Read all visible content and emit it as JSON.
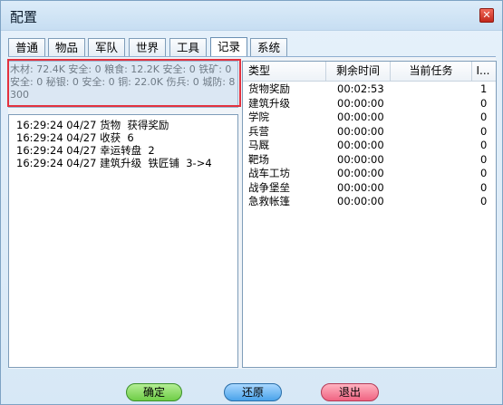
{
  "window": {
    "title": "配置"
  },
  "tabs": [
    {
      "label": "普通"
    },
    {
      "label": "物品"
    },
    {
      "label": "军队"
    },
    {
      "label": "世界"
    },
    {
      "label": "工具"
    },
    {
      "label": "记录",
      "active": true
    },
    {
      "label": "系统"
    }
  ],
  "stats": {
    "text": "木材: 72.4K 安全: 0 粮食: 12.2K 安全: 0 铁矿: 0 安全: 0 秘银: 0 安全: 0 铜: 22.0K 伤兵: 0 城防: 8300"
  },
  "log": {
    "lines": [
      "16:29:24 04/27 货物  获得奖励",
      "16:29:24 04/27 收获  6",
      "16:29:24 04/27 幸运转盘  2",
      "16:29:24 04/27 建筑升级  铁匠铺  3->4"
    ]
  },
  "table": {
    "columns": [
      "类型",
      "剩余时间",
      "当前任务",
      "I..."
    ],
    "rows": [
      {
        "type": "货物奖励",
        "time": "00:02:53",
        "task": "",
        "count": "1"
      },
      {
        "type": "建筑升级",
        "time": "00:00:00",
        "task": "",
        "count": "0"
      },
      {
        "type": "学院",
        "time": "00:00:00",
        "task": "",
        "count": "0"
      },
      {
        "type": "兵营",
        "time": "00:00:00",
        "task": "",
        "count": "0"
      },
      {
        "type": "马厩",
        "time": "00:00:00",
        "task": "",
        "count": "0"
      },
      {
        "type": "靶场",
        "time": "00:00:00",
        "task": "",
        "count": "0"
      },
      {
        "type": "战车工坊",
        "time": "00:00:00",
        "task": "",
        "count": "0"
      },
      {
        "type": "战争堡垒",
        "time": "00:00:00",
        "task": "",
        "count": "0"
      },
      {
        "type": "急救帐篷",
        "time": "00:00:00",
        "task": "",
        "count": "0"
      }
    ]
  },
  "buttons": {
    "ok": "确定",
    "restore": "还原",
    "exit": "退出"
  },
  "colors": {
    "highlight": "#e3323f",
    "ok": "#6fcd47",
    "restore": "#4aa3ea",
    "exit": "#f06482"
  },
  "icons": {
    "close": "close-icon"
  }
}
